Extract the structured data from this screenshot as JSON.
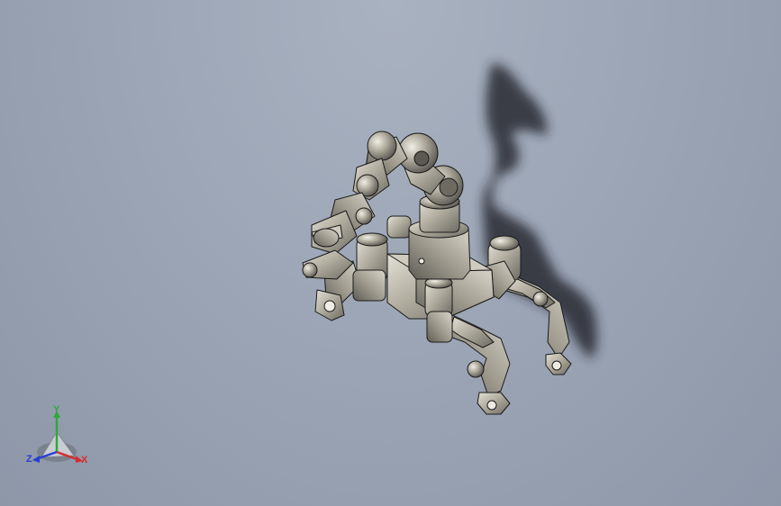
{
  "viewport": {
    "background_top": "#a9b2c0",
    "background_bottom": "#8d97a8"
  },
  "model": {
    "icon": "robot-arm-quadruped-model",
    "body_color": "#a39f92",
    "edge_color": "#1a1a1a",
    "shadow_color": "#20242c"
  },
  "triad": {
    "x_label": "X",
    "y_label": "Y",
    "z_label": "Z",
    "x_color": "#d23030",
    "y_color": "#2fa83a",
    "z_color": "#2a3fd0"
  }
}
